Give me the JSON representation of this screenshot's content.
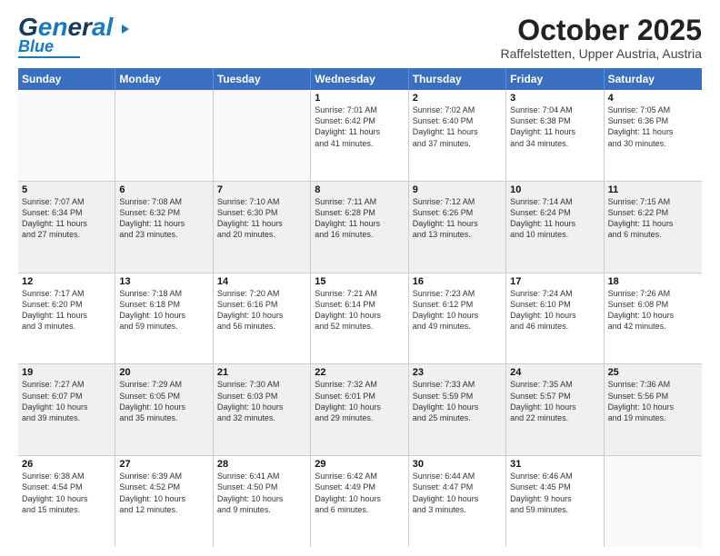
{
  "header": {
    "logo_general": "General",
    "logo_blue": "Blue",
    "month": "October 2025",
    "location": "Raffelstetten, Upper Austria, Austria"
  },
  "days_of_week": [
    "Sunday",
    "Monday",
    "Tuesday",
    "Wednesday",
    "Thursday",
    "Friday",
    "Saturday"
  ],
  "weeks": [
    [
      {
        "day": "",
        "text": "",
        "empty": true
      },
      {
        "day": "",
        "text": "",
        "empty": true
      },
      {
        "day": "",
        "text": "",
        "empty": true
      },
      {
        "day": "1",
        "text": "Sunrise: 7:01 AM\nSunset: 6:42 PM\nDaylight: 11 hours\nand 41 minutes."
      },
      {
        "day": "2",
        "text": "Sunrise: 7:02 AM\nSunset: 6:40 PM\nDaylight: 11 hours\nand 37 minutes."
      },
      {
        "day": "3",
        "text": "Sunrise: 7:04 AM\nSunset: 6:38 PM\nDaylight: 11 hours\nand 34 minutes."
      },
      {
        "day": "4",
        "text": "Sunrise: 7:05 AM\nSunset: 6:36 PM\nDaylight: 11 hours\nand 30 minutes."
      }
    ],
    [
      {
        "day": "5",
        "text": "Sunrise: 7:07 AM\nSunset: 6:34 PM\nDaylight: 11 hours\nand 27 minutes.",
        "shaded": true
      },
      {
        "day": "6",
        "text": "Sunrise: 7:08 AM\nSunset: 6:32 PM\nDaylight: 11 hours\nand 23 minutes.",
        "shaded": true
      },
      {
        "day": "7",
        "text": "Sunrise: 7:10 AM\nSunset: 6:30 PM\nDaylight: 11 hours\nand 20 minutes.",
        "shaded": true
      },
      {
        "day": "8",
        "text": "Sunrise: 7:11 AM\nSunset: 6:28 PM\nDaylight: 11 hours\nand 16 minutes.",
        "shaded": true
      },
      {
        "day": "9",
        "text": "Sunrise: 7:12 AM\nSunset: 6:26 PM\nDaylight: 11 hours\nand 13 minutes.",
        "shaded": true
      },
      {
        "day": "10",
        "text": "Sunrise: 7:14 AM\nSunset: 6:24 PM\nDaylight: 11 hours\nand 10 minutes.",
        "shaded": true
      },
      {
        "day": "11",
        "text": "Sunrise: 7:15 AM\nSunset: 6:22 PM\nDaylight: 11 hours\nand 6 minutes.",
        "shaded": true
      }
    ],
    [
      {
        "day": "12",
        "text": "Sunrise: 7:17 AM\nSunset: 6:20 PM\nDaylight: 11 hours\nand 3 minutes."
      },
      {
        "day": "13",
        "text": "Sunrise: 7:18 AM\nSunset: 6:18 PM\nDaylight: 10 hours\nand 59 minutes."
      },
      {
        "day": "14",
        "text": "Sunrise: 7:20 AM\nSunset: 6:16 PM\nDaylight: 10 hours\nand 56 minutes."
      },
      {
        "day": "15",
        "text": "Sunrise: 7:21 AM\nSunset: 6:14 PM\nDaylight: 10 hours\nand 52 minutes."
      },
      {
        "day": "16",
        "text": "Sunrise: 7:23 AM\nSunset: 6:12 PM\nDaylight: 10 hours\nand 49 minutes."
      },
      {
        "day": "17",
        "text": "Sunrise: 7:24 AM\nSunset: 6:10 PM\nDaylight: 10 hours\nand 46 minutes."
      },
      {
        "day": "18",
        "text": "Sunrise: 7:26 AM\nSunset: 6:08 PM\nDaylight: 10 hours\nand 42 minutes."
      }
    ],
    [
      {
        "day": "19",
        "text": "Sunrise: 7:27 AM\nSunset: 6:07 PM\nDaylight: 10 hours\nand 39 minutes.",
        "shaded": true
      },
      {
        "day": "20",
        "text": "Sunrise: 7:29 AM\nSunset: 6:05 PM\nDaylight: 10 hours\nand 35 minutes.",
        "shaded": true
      },
      {
        "day": "21",
        "text": "Sunrise: 7:30 AM\nSunset: 6:03 PM\nDaylight: 10 hours\nand 32 minutes.",
        "shaded": true
      },
      {
        "day": "22",
        "text": "Sunrise: 7:32 AM\nSunset: 6:01 PM\nDaylight: 10 hours\nand 29 minutes.",
        "shaded": true
      },
      {
        "day": "23",
        "text": "Sunrise: 7:33 AM\nSunset: 5:59 PM\nDaylight: 10 hours\nand 25 minutes.",
        "shaded": true
      },
      {
        "day": "24",
        "text": "Sunrise: 7:35 AM\nSunset: 5:57 PM\nDaylight: 10 hours\nand 22 minutes.",
        "shaded": true
      },
      {
        "day": "25",
        "text": "Sunrise: 7:36 AM\nSunset: 5:56 PM\nDaylight: 10 hours\nand 19 minutes.",
        "shaded": true
      }
    ],
    [
      {
        "day": "26",
        "text": "Sunrise: 6:38 AM\nSunset: 4:54 PM\nDaylight: 10 hours\nand 15 minutes."
      },
      {
        "day": "27",
        "text": "Sunrise: 6:39 AM\nSunset: 4:52 PM\nDaylight: 10 hours\nand 12 minutes."
      },
      {
        "day": "28",
        "text": "Sunrise: 6:41 AM\nSunset: 4:50 PM\nDaylight: 10 hours\nand 9 minutes."
      },
      {
        "day": "29",
        "text": "Sunrise: 6:42 AM\nSunset: 4:49 PM\nDaylight: 10 hours\nand 6 minutes."
      },
      {
        "day": "30",
        "text": "Sunrise: 6:44 AM\nSunset: 4:47 PM\nDaylight: 10 hours\nand 3 minutes."
      },
      {
        "day": "31",
        "text": "Sunrise: 6:46 AM\nSunset: 4:45 PM\nDaylight: 9 hours\nand 59 minutes."
      },
      {
        "day": "",
        "text": "",
        "empty": true
      }
    ]
  ]
}
